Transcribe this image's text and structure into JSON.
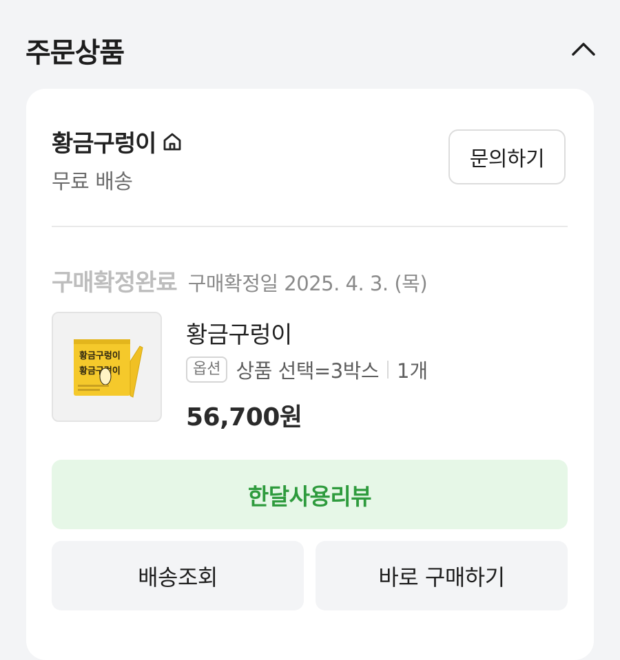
{
  "section": {
    "title": "주문상품"
  },
  "seller": {
    "name": "황금구렁이",
    "shipping": "무료 배송",
    "inquiry_label": "문의하기"
  },
  "order": {
    "status": "구매확정완료",
    "confirm_date": "구매확정일 2025. 4. 3. (목)"
  },
  "product": {
    "name": "황금구렁이",
    "option_badge": "옵션",
    "option_text": "상품 선택=3박스",
    "quantity": "1개",
    "price": "56,700원",
    "thumbnail_text_top": "황금구렁이",
    "thumbnail_text_bottom": "황금구렁이"
  },
  "actions": {
    "review": "한달사용리뷰",
    "track": "배송조회",
    "buy_again": "바로 구매하기"
  },
  "colors": {
    "background": "#f3f4f6",
    "card": "#ffffff",
    "review_bg": "#e6f7e7",
    "review_text": "#2e9b3d",
    "status_text": "#bdbdbd"
  }
}
